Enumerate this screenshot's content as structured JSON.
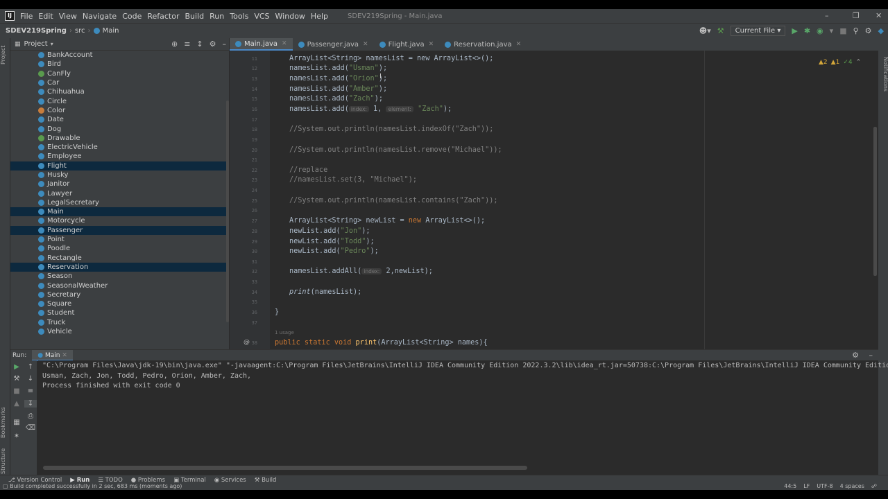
{
  "menu": {
    "items": [
      "File",
      "Edit",
      "View",
      "Navigate",
      "Code",
      "Refactor",
      "Build",
      "Run",
      "Tools",
      "VCS",
      "Window",
      "Help"
    ],
    "window_title": "SDEV219Spring - Main.java"
  },
  "navbar": {
    "breadcrumbs": [
      "SDEV219Spring",
      "src",
      "Main"
    ],
    "run_config": "Current File"
  },
  "project": {
    "title": "Project",
    "items": [
      {
        "name": "BankAccount",
        "kind": "class",
        "selected": false
      },
      {
        "name": "Bird",
        "kind": "class",
        "selected": false
      },
      {
        "name": "CanFly",
        "kind": "interface",
        "selected": false
      },
      {
        "name": "Car",
        "kind": "class",
        "selected": false
      },
      {
        "name": "Chihuahua",
        "kind": "class",
        "selected": false
      },
      {
        "name": "Circle",
        "kind": "class",
        "selected": false
      },
      {
        "name": "Color",
        "kind": "enum",
        "selected": false
      },
      {
        "name": "Date",
        "kind": "class",
        "selected": false
      },
      {
        "name": "Dog",
        "kind": "class",
        "selected": false
      },
      {
        "name": "Drawable",
        "kind": "interface",
        "selected": false
      },
      {
        "name": "ElectricVehicle",
        "kind": "class",
        "selected": false
      },
      {
        "name": "Employee",
        "kind": "class",
        "selected": false
      },
      {
        "name": "Flight",
        "kind": "class",
        "selected": true
      },
      {
        "name": "Husky",
        "kind": "class",
        "selected": false
      },
      {
        "name": "Janitor",
        "kind": "class",
        "selected": false
      },
      {
        "name": "Lawyer",
        "kind": "class",
        "selected": false
      },
      {
        "name": "LegalSecretary",
        "kind": "class",
        "selected": false
      },
      {
        "name": "Main",
        "kind": "class",
        "selected": true
      },
      {
        "name": "Motorcycle",
        "kind": "class",
        "selected": false
      },
      {
        "name": "Passenger",
        "kind": "class",
        "selected": true
      },
      {
        "name": "Point",
        "kind": "class",
        "selected": false
      },
      {
        "name": "Poodle",
        "kind": "class",
        "selected": false
      },
      {
        "name": "Rectangle",
        "kind": "class",
        "selected": false
      },
      {
        "name": "Reservation",
        "kind": "class",
        "selected": true
      },
      {
        "name": "Season",
        "kind": "class",
        "selected": false
      },
      {
        "name": "SeasonalWeather",
        "kind": "class",
        "selected": false
      },
      {
        "name": "Secretary",
        "kind": "class",
        "selected": false
      },
      {
        "name": "Square",
        "kind": "class",
        "selected": false
      },
      {
        "name": "Student",
        "kind": "class",
        "selected": false
      },
      {
        "name": "Truck",
        "kind": "class",
        "selected": false
      },
      {
        "name": "Vehicle",
        "kind": "class",
        "selected": false
      }
    ]
  },
  "editor": {
    "tabs": [
      {
        "label": "Main.java",
        "active": true
      },
      {
        "label": "Passenger.java",
        "active": false
      },
      {
        "label": "Flight.java",
        "active": false
      },
      {
        "label": "Reservation.java",
        "active": false
      }
    ],
    "inspections": {
      "warnings": "2",
      "weak_warnings": "1",
      "typos": "4"
    },
    "lines": {
      "l10": "ArrayList<String> namesList = new ArrayList<>();",
      "l12_a": "namesList.add(",
      "l12_s": "\"Usman\"",
      "l12_b": ");",
      "l13_a": "namesList.add(",
      "l13_s": "\"Orion\"",
      "l13_b": ");",
      "l14_a": "namesList.add(",
      "l14_s": "\"Amber\"",
      "l14_b": ");",
      "l15_a": "namesList.add(",
      "l15_s": "\"Zach\"",
      "l15_b": ");",
      "l16_a": "namesList.add(",
      "l16_hint1": "index:",
      "l16_mid": " 1, ",
      "l16_hint2": "element:",
      "l16_s": " \"Zach\"",
      "l16_b": ");",
      "c18": "//System.out.println(namesList.indexOf(\"Zach\"));",
      "c20": "//System.out.println(namesList.remove(\"Michael\"));",
      "c22": "//replace",
      "c23": "//namesList.set(3, \"Michael\");",
      "c25": "//System.out.println(namesList.contains(\"Zach\"));",
      "l27_a": "ArrayList<String> newList = ",
      "l27_kw": "new",
      "l27_b": " ArrayList<>();",
      "l28_a": "newList.add(",
      "l28_s": "\"Jon\"",
      "l28_b": ");",
      "l29_a": "newList.add(",
      "l29_s": "\"Todd\"",
      "l29_b": ");",
      "l30_a": "newList.add(",
      "l30_s": "\"Pedro\"",
      "l30_b": ");",
      "l32_a": "namesList.addAll(",
      "l32_hint": "index:",
      "l32_b": " 2,newList);",
      "l34_fn": "print",
      "l34_b": "(namesList);",
      "l36": "}",
      "usage": "1 usage",
      "l38_kw": "public static void ",
      "l38_fn": "print",
      "l38_b": "(ArrayList<String> names){"
    },
    "line_numbers": [
      "11",
      "12",
      "13",
      "14",
      "15",
      "16",
      "17",
      "18",
      "19",
      "20",
      "21",
      "22",
      "23",
      "24",
      "25",
      "26",
      "27",
      "28",
      "29",
      "30",
      "31",
      "32",
      "33",
      "34",
      "35",
      "36",
      "37",
      "38"
    ]
  },
  "run": {
    "label": "Run:",
    "tab": "Main",
    "output": [
      "\"C:\\Program Files\\Java\\jdk-19\\bin\\java.exe\" \"-javaagent:C:\\Program Files\\JetBrains\\IntelliJ IDEA Community Edition 2022.3.2\\lib\\idea_rt.jar=50738:C:\\Program Files\\JetBrains\\IntelliJ IDEA Community Edition 2022.3.2\\bin\" -Dfile.",
      "Usman, Zach, Jon, Todd, Pedro, Orion, Amber, Zach,",
      "Process finished with exit code 0"
    ]
  },
  "toolwindows": [
    "Version Control",
    "Run",
    "TODO",
    "Problems",
    "Terminal",
    "Services",
    "Build"
  ],
  "status": {
    "message": "Build completed successfully in 2 sec, 683 ms (moments ago)",
    "position": "44:5",
    "line_sep": "LF",
    "encoding": "UTF-8",
    "indent": "4 spaces"
  },
  "side_tabs": {
    "project": "Project",
    "bookmarks": "Bookmarks",
    "structure": "Structure",
    "notifications": "Notifications"
  }
}
